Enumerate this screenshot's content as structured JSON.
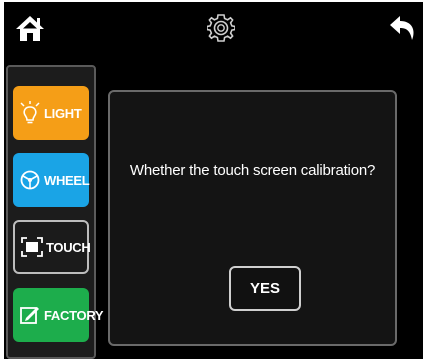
{
  "topbar": {
    "left_icon": "home-icon",
    "center_icon": "gear-icon",
    "right_icon": "back-arrow-icon"
  },
  "sidebar": {
    "items": [
      {
        "label": "LIGHT",
        "icon": "lightbulb-icon",
        "color": "#f59e17"
      },
      {
        "label": "WHEEL",
        "icon": "steering-wheel-icon",
        "color": "#1aa4e6"
      },
      {
        "label": "TOUCH",
        "icon": "touch-calibration-icon",
        "color": "#1b1b1b",
        "selected": true
      },
      {
        "label": "FACTORY",
        "icon": "factory-reset-icon",
        "color": "#1dad4c"
      }
    ]
  },
  "dialog": {
    "message": "Whether the touch screen calibration?",
    "confirm_label": "YES"
  }
}
